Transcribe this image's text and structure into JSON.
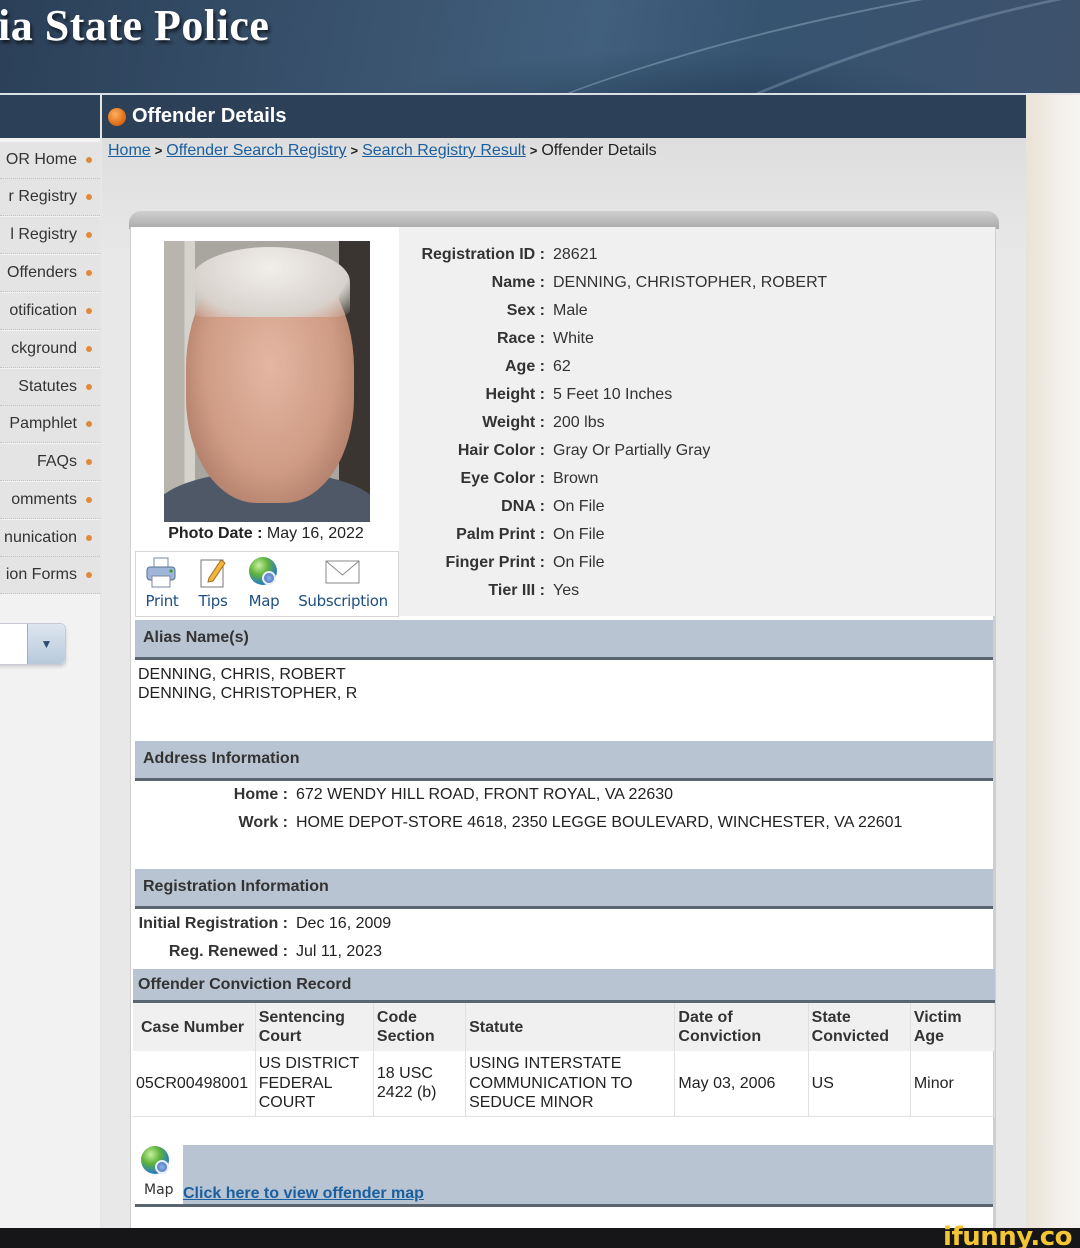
{
  "banner": {
    "title": "ia State Police"
  },
  "sidebar": {
    "items": [
      {
        "label": "OR Home"
      },
      {
        "label": "r Registry"
      },
      {
        "label": "l Registry"
      },
      {
        "label": "Offenders"
      },
      {
        "label": "otification"
      },
      {
        "label": "ckground"
      },
      {
        "label": "Statutes"
      },
      {
        "label": "Pamphlet"
      },
      {
        "label": "FAQs"
      },
      {
        "label": "omments"
      },
      {
        "label": "nunication"
      },
      {
        "label": "ion Forms"
      }
    ],
    "select_arrow": "▼"
  },
  "header": {
    "title": "Offender Details"
  },
  "breadcrumb": {
    "links": [
      "Home",
      "Offender Search Registry",
      "Search Registry Result"
    ],
    "current": "Offender Details",
    "separator": ">"
  },
  "photo": {
    "date_label": "Photo Date :",
    "date_value": "May 16, 2022"
  },
  "tools": [
    {
      "label": "Print",
      "icon": "printer-icon"
    },
    {
      "label": "Tips",
      "icon": "notepad-pencil-icon"
    },
    {
      "label": "Map",
      "icon": "globe-icon"
    },
    {
      "label": "Subscription",
      "icon": "envelope-icon"
    }
  ],
  "details": [
    {
      "label": "Registration ID :",
      "value": "28621"
    },
    {
      "label": "Name :",
      "value": "DENNING, CHRISTOPHER, ROBERT"
    },
    {
      "label": "Sex :",
      "value": "Male"
    },
    {
      "label": "Race :",
      "value": "White"
    },
    {
      "label": "Age :",
      "value": "62"
    },
    {
      "label": "Height :",
      "value": "5 Feet 10 Inches"
    },
    {
      "label": "Weight :",
      "value": "200 lbs"
    },
    {
      "label": "Hair Color :",
      "value": "Gray Or Partially Gray"
    },
    {
      "label": "Eye Color :",
      "value": "Brown"
    },
    {
      "label": "DNA :",
      "value": "On File"
    },
    {
      "label": "Palm Print :",
      "value": "On File"
    },
    {
      "label": "Finger Print :",
      "value": "On File"
    },
    {
      "label": "Tier III :",
      "value": "Yes"
    }
  ],
  "alias": {
    "heading": "Alias Name(s)",
    "names": [
      "DENNING, CHRIS, ROBERT",
      "DENNING, CHRISTOPHER, R"
    ]
  },
  "address": {
    "heading": "Address Information",
    "rows": [
      {
        "label": "Home :",
        "value": "672 WENDY HILL ROAD, FRONT ROYAL, VA 22630"
      },
      {
        "label": "Work :",
        "value": "HOME DEPOT-STORE 4618, 2350 LEGGE BOULEVARD, WINCHESTER, VA 22601"
      }
    ]
  },
  "registration": {
    "heading": "Registration Information",
    "rows": [
      {
        "label": "Initial Registration :",
        "value": "Dec 16, 2009"
      },
      {
        "label": "Reg. Renewed :",
        "value": "Jul 11, 2023"
      }
    ]
  },
  "conviction": {
    "heading": "Offender Conviction Record",
    "columns": [
      "Case Number",
      "Sentencing Court",
      "Code Section",
      "Statute",
      "Date of Conviction",
      "State Convicted",
      "Victim Age"
    ],
    "rows": [
      [
        "05CR00498001",
        "US DISTRICT FEDERAL COURT",
        "18 USC 2422 (b)",
        "USING INTERSTATE COMMUNICATION TO SEDUCE MINOR",
        "May 03, 2006",
        "US",
        "Minor"
      ]
    ]
  },
  "map": {
    "icon_label": "Map",
    "link_text": "Click here to view offender map"
  },
  "watermark": {
    "text": "ifunny.co"
  }
}
